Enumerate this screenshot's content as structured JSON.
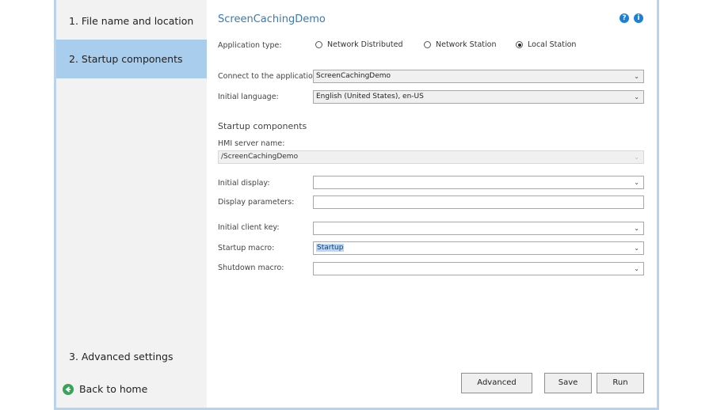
{
  "sidebar": {
    "steps": [
      {
        "label": "1. File name and location"
      },
      {
        "label": "2. Startup components"
      },
      {
        "label": "3. Advanced settings"
      }
    ],
    "back_label": "Back to home"
  },
  "main": {
    "title": "ScreenCachingDemo",
    "help_glyph": "?",
    "info_glyph": "i",
    "application_type": {
      "label": "Application type:",
      "options": [
        "Network Distributed",
        "Network Station",
        "Local Station"
      ],
      "selected": "Local Station"
    },
    "connect": {
      "label": "Connect to the application",
      "value": "ScreenCachingDemo"
    },
    "language": {
      "label": "Initial language:",
      "value": "English (United States), en-US"
    },
    "section_title": "Startup components",
    "hmi": {
      "label": "HMI server name:",
      "value": "/ScreenCachingDemo"
    },
    "initial_display": {
      "label": "Initial display:",
      "value": ""
    },
    "display_params": {
      "label": "Display parameters:",
      "value": ""
    },
    "client_key": {
      "label": "Initial client key:",
      "value": ""
    },
    "startup_macro": {
      "label": "Startup macro:",
      "value": "Startup"
    },
    "shutdown_macro": {
      "label": "Shutdown macro:",
      "value": ""
    },
    "buttons": {
      "advanced": "Advanced",
      "save": "Save",
      "run": "Run"
    }
  },
  "colors": {
    "accent": "#3a78b6",
    "active_step": "#a9cdec",
    "sidebar_bg": "#f2f2f2",
    "back_icon": "#3aa35b"
  },
  "icons": {
    "back": "arrow-left-circle-icon",
    "help": "help-icon",
    "info": "info-icon",
    "dropdown": "chevron-down-icon"
  }
}
